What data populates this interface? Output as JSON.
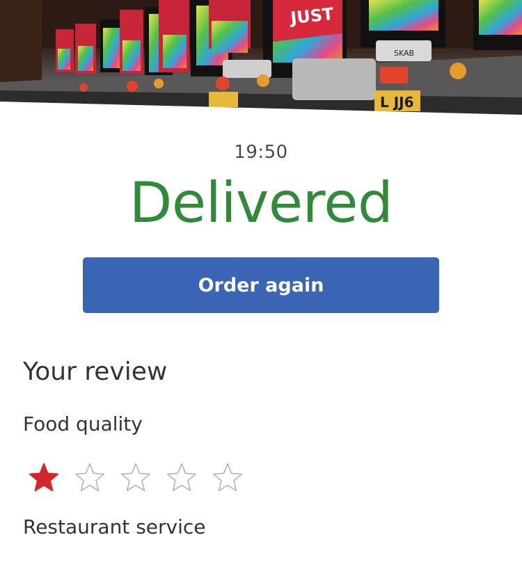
{
  "hero": {
    "image": "delivery-scooters-photo",
    "sign_text": "JUST EAT",
    "plate_text": "L JJ6",
    "brand_plate_text": "SKAB"
  },
  "order": {
    "time": "19:50",
    "status": "Delivered",
    "status_color": "#2f8a3a",
    "order_again_label": "Order again",
    "button_color": "#3a65b5"
  },
  "review": {
    "title": "Your review",
    "food_quality": {
      "label": "Food quality",
      "rating": 1,
      "max_rating": 5,
      "star_color": "#d1282e"
    },
    "restaurant_service": {
      "label": "Restaurant service"
    }
  }
}
